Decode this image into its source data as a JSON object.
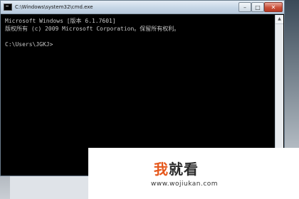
{
  "window": {
    "title": "C:\\Windows\\system32\\cmd.exe",
    "minimize_glyph": "–",
    "maximize_glyph": "□",
    "close_glyph": "✕"
  },
  "console": {
    "lines": [
      "Microsoft Windows [版本 6.1.7601]",
      "版权所有 (c) 2009 Microsoft Corporation。保留所有权利。",
      "",
      "C:\\Users\\JGKJ>"
    ]
  },
  "scrollbar": {
    "up_glyph": "▲",
    "down_glyph": "▼"
  },
  "watermark": {
    "logo_first": "我",
    "logo_rest": "就看",
    "url": "www.wojiukan.com"
  },
  "colors": {
    "console_bg": "#000000",
    "console_text": "#c8c8c8",
    "logo_accent": "#e6581c"
  }
}
